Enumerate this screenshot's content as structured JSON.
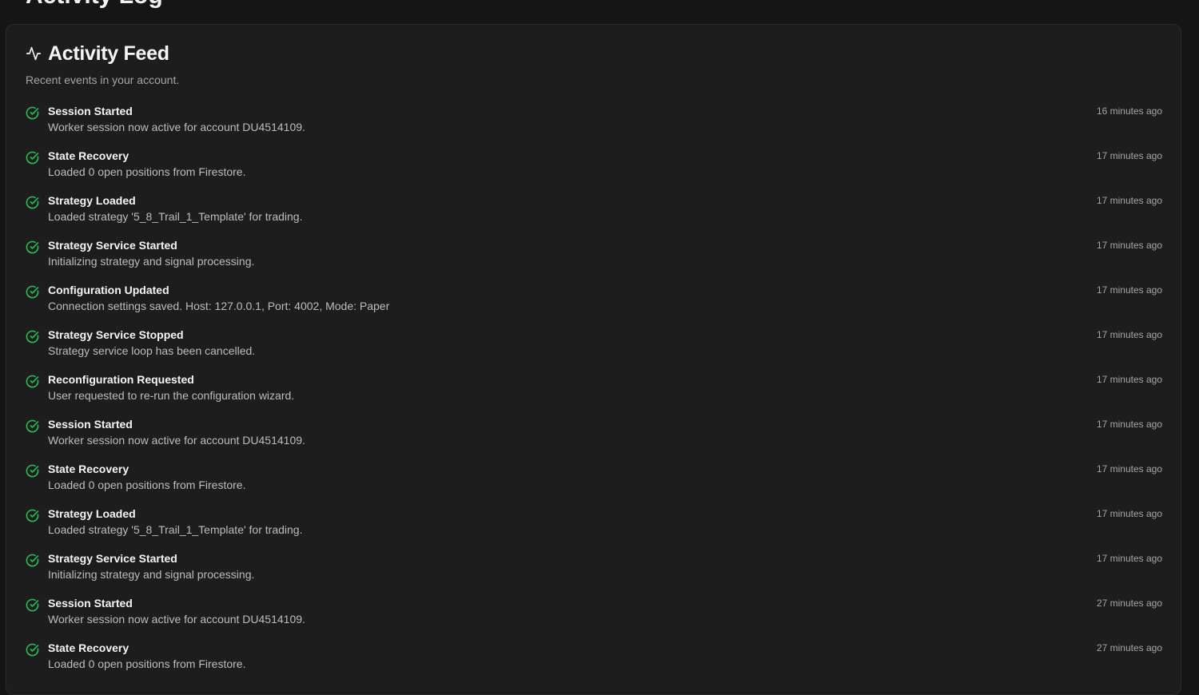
{
  "page": {
    "heading": "Activity Log"
  },
  "card": {
    "title": "Activity Feed",
    "subtitle": "Recent events in your account.",
    "title_icon": "activity-pulse-icon",
    "item_icon": "check-circle-icon"
  },
  "colors": {
    "background": "#151515",
    "card": "#1d1d1d",
    "success": "#22c55e",
    "muted_text": "#a6a6a6"
  },
  "events": [
    {
      "title": "Session Started",
      "description": "Worker session now active for account DU4514109.",
      "time": "16 minutes ago"
    },
    {
      "title": "State Recovery",
      "description": "Loaded 0 open positions from Firestore.",
      "time": "17 minutes ago"
    },
    {
      "title": "Strategy Loaded",
      "description": "Loaded strategy '5_8_Trail_1_Template' for trading.",
      "time": "17 minutes ago"
    },
    {
      "title": "Strategy Service Started",
      "description": "Initializing strategy and signal processing.",
      "time": "17 minutes ago"
    },
    {
      "title": "Configuration Updated",
      "description": "Connection settings saved. Host: 127.0.0.1, Port: 4002, Mode: Paper",
      "time": "17 minutes ago"
    },
    {
      "title": "Strategy Service Stopped",
      "description": "Strategy service loop has been cancelled.",
      "time": "17 minutes ago"
    },
    {
      "title": "Reconfiguration Requested",
      "description": "User requested to re-run the configuration wizard.",
      "time": "17 minutes ago"
    },
    {
      "title": "Session Started",
      "description": "Worker session now active for account DU4514109.",
      "time": "17 minutes ago"
    },
    {
      "title": "State Recovery",
      "description": "Loaded 0 open positions from Firestore.",
      "time": "17 minutes ago"
    },
    {
      "title": "Strategy Loaded",
      "description": "Loaded strategy '5_8_Trail_1_Template' for trading.",
      "time": "17 minutes ago"
    },
    {
      "title": "Strategy Service Started",
      "description": "Initializing strategy and signal processing.",
      "time": "17 minutes ago"
    },
    {
      "title": "Session Started",
      "description": "Worker session now active for account DU4514109.",
      "time": "27 minutes ago"
    },
    {
      "title": "State Recovery",
      "description": "Loaded 0 open positions from Firestore.",
      "time": "27 minutes ago"
    }
  ]
}
